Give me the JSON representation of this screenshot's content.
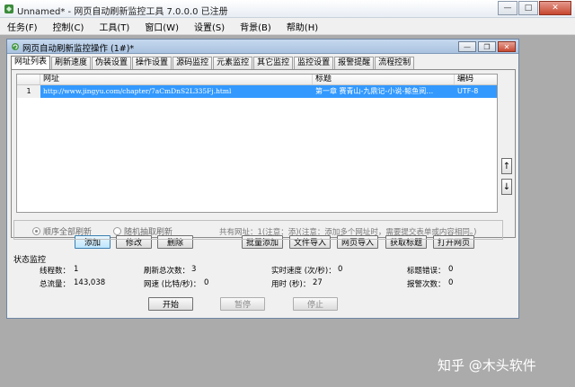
{
  "app": {
    "title": "Unnamed* - 网页自动刷新监控工具 7.0.0.0 已注册",
    "minimize": "—",
    "maximize": "□",
    "close": "✕"
  },
  "menu": [
    "任务(F)",
    "控制(C)",
    "工具(T)",
    "窗口(W)",
    "设置(S)",
    "背景(B)",
    "帮助(H)"
  ],
  "child": {
    "title": "网页自动刷新监控操作 (1#)*",
    "minimize": "—",
    "restore": "❐",
    "close": "✕"
  },
  "tabs": [
    "网址列表",
    "刷新速度",
    "伪装设置",
    "操作设置",
    "源码监控",
    "元素监控",
    "其它监控",
    "监控设置",
    "报警提醒",
    "流程控制"
  ],
  "grid": {
    "headers": [
      "",
      "网址",
      "标题",
      "编码"
    ],
    "rows": [
      {
        "index": "1",
        "url": "http://www.jingyu.com/chapter/7aCmDnS2L335Fj.html",
        "title": "第一章 赛青山-九鼎记-小说-鲸鱼阅…",
        "encoding": "UTF-8"
      }
    ]
  },
  "side": {
    "up": "↑",
    "down": "↓"
  },
  "buttons": {
    "add": "添加",
    "edit": "修改",
    "delete": "删除",
    "batch_add": "批量添加",
    "file_import": "文件导入",
    "web_import": "网页导入",
    "get_title": "获取标题",
    "open_page": "打开网页"
  },
  "radio": {
    "sequential": "顺序全部刷新",
    "random": "随机抽取刷新",
    "note": "共有网址：1(注意：添)(注意：添加多个网址时，需要提交表单或内容相同。)"
  },
  "status": {
    "label": "状态监控",
    "threads_label": "线程数：",
    "threads": "1",
    "refresh_total_label": "刷新总次数：",
    "refresh_total": "3",
    "speed_label": "实时速度 (次/秒)：",
    "speed": "0",
    "title_errors_label": "标题错误：",
    "title_errors": "0",
    "traffic_label": "总流量：",
    "traffic": "143,038",
    "rate_label": "网速 (比特/秒)：",
    "rate": "0",
    "elapsed_label": "用时 (秒)：",
    "elapsed": "27",
    "alarms_label": "报警次数：",
    "alarms": "0"
  },
  "controls": {
    "start": "开始",
    "pause": "暂停",
    "stop": "停止"
  },
  "watermark": "知乎 @木头软件"
}
